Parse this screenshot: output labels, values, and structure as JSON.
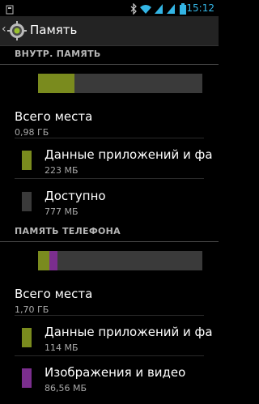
{
  "status_bar": {
    "time": "15:12",
    "icons": [
      "usb-icon",
      "bluetooth-icon",
      "wifi-icon",
      "signal-1-icon",
      "signal-2-icon",
      "battery-icon"
    ]
  },
  "action_bar": {
    "title": "Память",
    "icon": "gear-icon"
  },
  "internal": {
    "header": "ВНУТР. ПАМЯТЬ",
    "usage_fractions": {
      "apps": 0.22
    },
    "total": {
      "title": "Всего места",
      "value": "0,98 ГБ"
    },
    "items": [
      {
        "title": "Данные приложений и фа",
        "value": "223 МБ",
        "color": "#7a8b1e"
      },
      {
        "title": "Доступно",
        "value": "777 МБ",
        "color": "#3a3a3a"
      }
    ]
  },
  "phone": {
    "header": "ПАМЯТЬ ТЕЛЕФОНА",
    "usage_fractions": {
      "apps": 0.067,
      "images": 0.05
    },
    "total": {
      "title": "Всего места",
      "value": "1,70 ГБ"
    },
    "items": [
      {
        "title": "Данные приложений и фа",
        "value": "114 МБ",
        "color": "#7a8b1e"
      },
      {
        "title": "Изображения и видео",
        "value": "86,56 МБ",
        "color": "#7b2e8e"
      }
    ]
  },
  "colors": {
    "accent_time": "#33b5e5",
    "apps": "#7a8b1e",
    "images": "#7b2e8e",
    "bar_bg": "#3a3a3a"
  }
}
